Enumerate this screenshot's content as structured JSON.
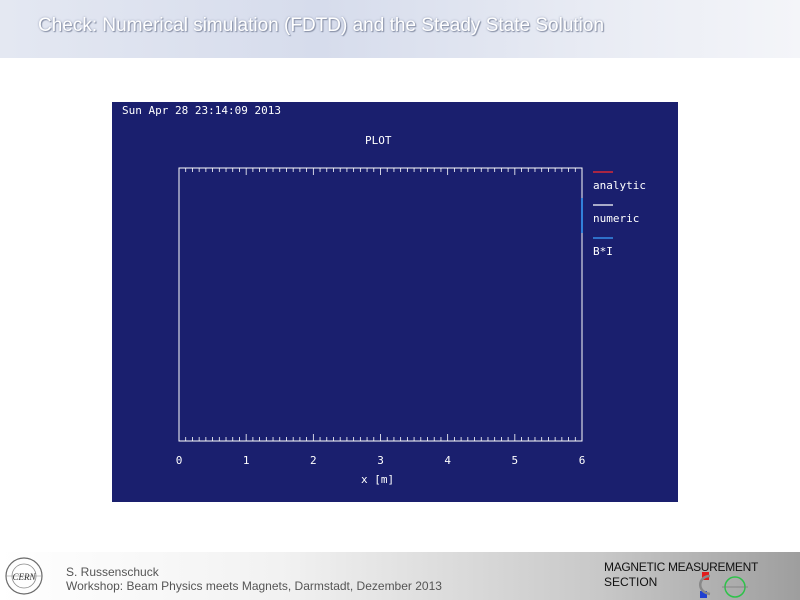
{
  "slide": {
    "title": "Check: Numerical simulation (FDTD) and the Steady State Solution"
  },
  "plot": {
    "timestamp": "Sun Apr 28 23:14:09 2013"
  },
  "chart_data": {
    "type": "line",
    "title": "PLOT",
    "xlabel": "x [m]",
    "ylabel": "",
    "xlim": [
      0,
      6
    ],
    "x_ticks": [
      "0",
      "1",
      "2",
      "3",
      "4",
      "5",
      "6"
    ],
    "grid": false,
    "legend_position": "right",
    "series": [
      {
        "name": "analytic",
        "color": "#ff2a2a",
        "x": [],
        "y": []
      },
      {
        "name": "numeric",
        "color": "#ffffff",
        "x": [],
        "y": []
      },
      {
        "name": "B*I",
        "color": "#3aa0ff",
        "x": [],
        "y": []
      }
    ]
  },
  "colors": {
    "plot_background": "#1a1f6e",
    "axis_color": "#ffffff"
  },
  "footer": {
    "author": "S. Russenschuck",
    "workshop": "Workshop: Beam Physics meets Magnets, Darmstadt, Dezember 2013",
    "section_line1": "MAGNETIC MEASUREMENT",
    "section_line2": "SECTION",
    "cern_logo_text": "CERN"
  }
}
